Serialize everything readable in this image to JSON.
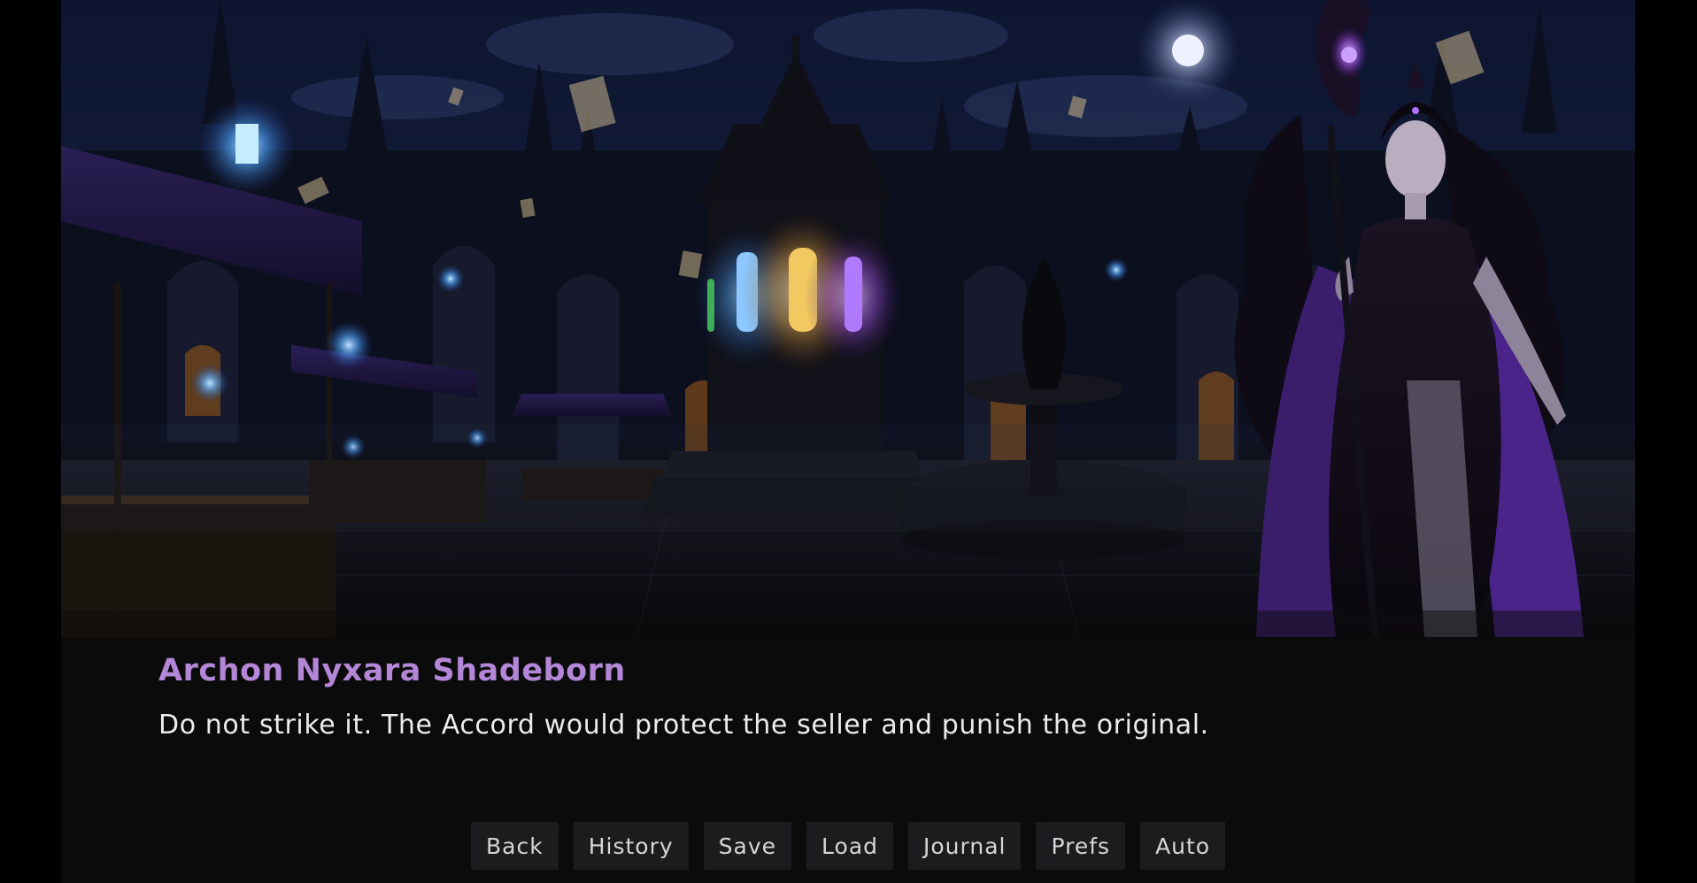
{
  "scene": {
    "location": "gothic night market plaza",
    "colors": {
      "sky": "#0d1530",
      "lantern_blue": "#4fa6ff",
      "lantern_gold": "#f2c860",
      "lantern_purple": "#9a4fe0",
      "character_violet": "#5b2a9c"
    }
  },
  "dialogue": {
    "speaker": "Archon Nyxara Shadeborn",
    "speaker_color": "#b486d8",
    "text": "Do not strike it. The Accord would protect the seller and punish the original."
  },
  "quick_menu": [
    {
      "label": "Back"
    },
    {
      "label": "History"
    },
    {
      "label": "Save"
    },
    {
      "label": "Load"
    },
    {
      "label": "Journal"
    },
    {
      "label": "Prefs"
    },
    {
      "label": "Auto"
    }
  ]
}
